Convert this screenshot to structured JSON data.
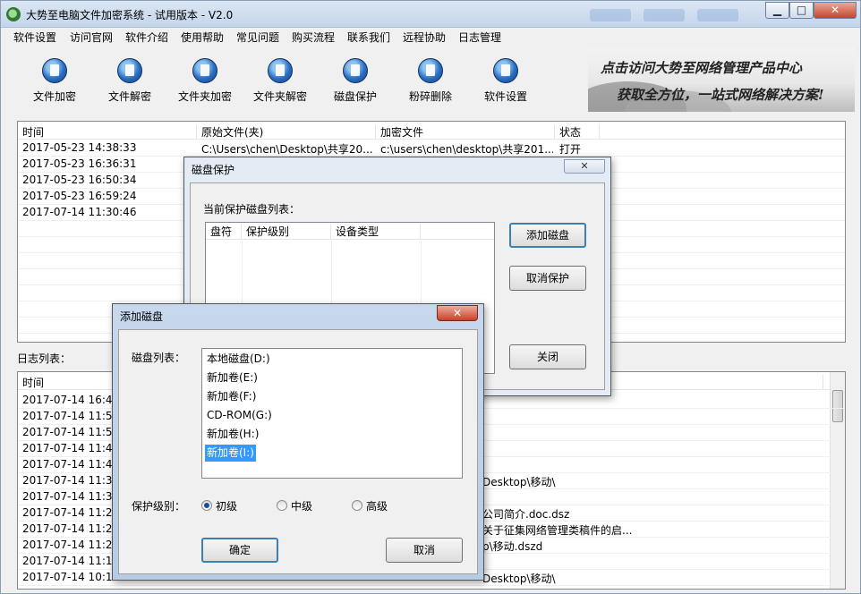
{
  "window": {
    "title": "大势至电脑文件加密系统 - 试用版本 - V2.0",
    "minimize": "▁",
    "maximize": "□",
    "close": "✕"
  },
  "menu": [
    "软件设置",
    "访问官网",
    "软件介绍",
    "使用帮助",
    "常见问题",
    "购买流程",
    "联系我们",
    "远程协助",
    "日志管理"
  ],
  "toolbar": [
    {
      "label": "文件加密",
      "icon": "file-lock-icon"
    },
    {
      "label": "文件解密",
      "icon": "file-unlock-icon"
    },
    {
      "label": "文件夹加密",
      "icon": "folder-lock-icon"
    },
    {
      "label": "文件夹解密",
      "icon": "folder-unlock-icon"
    },
    {
      "label": "磁盘保护",
      "icon": "disk-shield-icon"
    },
    {
      "label": "粉碎删除",
      "icon": "shred-icon"
    },
    {
      "label": "软件设置",
      "icon": "gear-icon"
    }
  ],
  "banner": {
    "line1": "点击访问大势至网络管理产品中心",
    "line2": "获取全方位，一站式网络解决方案!"
  },
  "records": {
    "columns": [
      "时间",
      "原始文件(夹)",
      "加密文件",
      "状态"
    ],
    "rows": [
      {
        "time": "2017-05-23 14:38:33",
        "original": "C:\\Users\\chen\\Desktop\\共享20...",
        "encrypted": "c:\\users\\chen\\desktop\\共享201...",
        "status": "打开"
      },
      {
        "time": "2017-05-23 16:36:31",
        "original": "",
        "encrypted": "",
        "status": ""
      },
      {
        "time": "2017-05-23 16:50:34",
        "original": "",
        "encrypted": "",
        "status": ""
      },
      {
        "time": "2017-05-23 16:59:24",
        "original": "",
        "encrypted": "",
        "status": ""
      },
      {
        "time": "2017-07-14 11:30:46",
        "original": "",
        "encrypted": "",
        "status": ""
      }
    ]
  },
  "log": {
    "label": "日志列表：",
    "column_time": "时间",
    "rows": [
      {
        "time": "2017-07-14 16:47",
        "detail": ""
      },
      {
        "time": "2017-07-14 11:51",
        "detail": ""
      },
      {
        "time": "2017-07-14 11:50",
        "detail": ""
      },
      {
        "time": "2017-07-14 11:48",
        "detail": ""
      },
      {
        "time": "2017-07-14 11:47",
        "detail": ""
      },
      {
        "time": "2017-07-14 11:30",
        "detail": "Desktop\\移动\\"
      },
      {
        "time": "2017-07-14 11:30",
        "detail": ""
      },
      {
        "time": "2017-07-14 11:26",
        "detail": "公司简介.doc.dsz"
      },
      {
        "time": "2017-07-14 11:26",
        "detail": "关于征集网络管理类稿件的启..."
      },
      {
        "time": "2017-07-14 11:25",
        "detail": "p\\移动.dszd"
      },
      {
        "time": "2017-07-14 11:13",
        "detail": ""
      },
      {
        "time": "2017-07-14 10:18",
        "detail": "Desktop\\移动\\"
      }
    ]
  },
  "disk_protect": {
    "title": "磁盘保护",
    "list_label": "当前保护磁盘列表：",
    "columns": [
      "盘符",
      "保护级别",
      "设备类型"
    ],
    "add_button": "添加磁盘",
    "cancel_button": "取消保护",
    "close_button": "关闭",
    "close_x": "✕"
  },
  "add_disk": {
    "title": "添加磁盘",
    "close_x": "✕",
    "list_label": "磁盘列表：",
    "disks": [
      "本地磁盘(D:)",
      "新加卷(E:)",
      "新加卷(F:)",
      "CD-ROM(G:)",
      "新加卷(H:)",
      "新加卷(I:)"
    ],
    "selected_index": 5,
    "level_label": "保护级别：",
    "levels": [
      "初级",
      "中级",
      "高级"
    ],
    "selected_level": "初级",
    "ok": "确定",
    "cancel": "取消"
  }
}
